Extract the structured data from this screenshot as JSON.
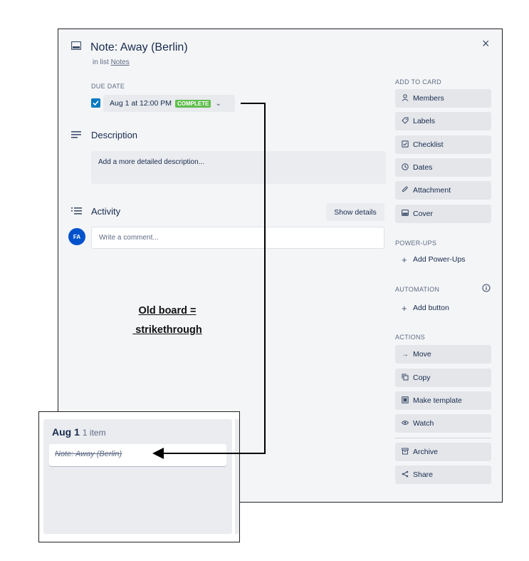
{
  "card": {
    "title": "Note: Away (Berlin)",
    "in_list_prefix": "in list",
    "list_name": "Notes",
    "close": "×"
  },
  "due_date": {
    "label": "DUE DATE",
    "value": "Aug 1 at 12:00 PM",
    "status": "COMPLETE",
    "checked": true
  },
  "description": {
    "title": "Description",
    "placeholder": "Add a more detailed description..."
  },
  "activity": {
    "title": "Activity",
    "show_details": "Show details",
    "avatar_initials": "FA",
    "comment_placeholder": "Write a comment..."
  },
  "sidebar": {
    "add_to_card_label": "ADD TO CARD",
    "add_to_card": [
      {
        "label": "Members",
        "icon": "person-icon"
      },
      {
        "label": "Labels",
        "icon": "tag-icon"
      },
      {
        "label": "Checklist",
        "icon": "checklist-icon"
      },
      {
        "label": "Dates",
        "icon": "clock-icon"
      },
      {
        "label": "Attachment",
        "icon": "paperclip-icon"
      },
      {
        "label": "Cover",
        "icon": "cover-icon"
      }
    ],
    "powerups_label": "POWER-UPS",
    "add_powerups": "Add Power-Ups",
    "automation_label": "AUTOMATION",
    "add_button": "Add button",
    "actions_label": "ACTIONS",
    "actions": [
      {
        "label": "Move",
        "icon": "arrow-right-icon"
      },
      {
        "label": "Copy",
        "icon": "copy-icon"
      },
      {
        "label": "Make template",
        "icon": "template-icon"
      },
      {
        "label": "Watch",
        "icon": "eye-icon"
      }
    ],
    "more_actions": [
      {
        "label": "Archive",
        "icon": "archive-icon"
      },
      {
        "label": "Share",
        "icon": "share-icon"
      }
    ]
  },
  "annotation": {
    "line1": "Old board =",
    "line2": " strikethrough"
  },
  "old_board": {
    "list_title": "Aug 1",
    "count": "1 item",
    "card_title": "Note: Away (Berlin)"
  },
  "colors": {
    "accent": "#0079bf",
    "complete": "#61bd4f",
    "avatar": "#0052cc"
  }
}
